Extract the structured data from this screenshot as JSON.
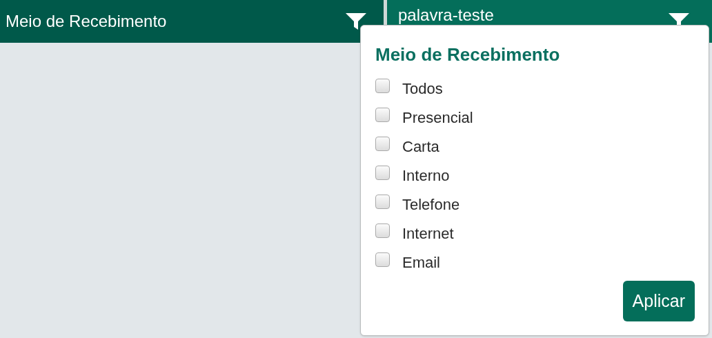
{
  "columns": [
    {
      "label": "Meio de Recebimento"
    },
    {
      "label": "palavra-teste"
    }
  ],
  "filter_popup": {
    "title": "Meio de Recebimento",
    "options": [
      {
        "label": "Todos",
        "checked": false
      },
      {
        "label": "Presencial",
        "checked": false
      },
      {
        "label": "Carta",
        "checked": false
      },
      {
        "label": "Interno",
        "checked": false
      },
      {
        "label": "Telefone",
        "checked": false
      },
      {
        "label": "Internet",
        "checked": false
      },
      {
        "label": "Email",
        "checked": false
      }
    ],
    "button": "Aplicar"
  }
}
